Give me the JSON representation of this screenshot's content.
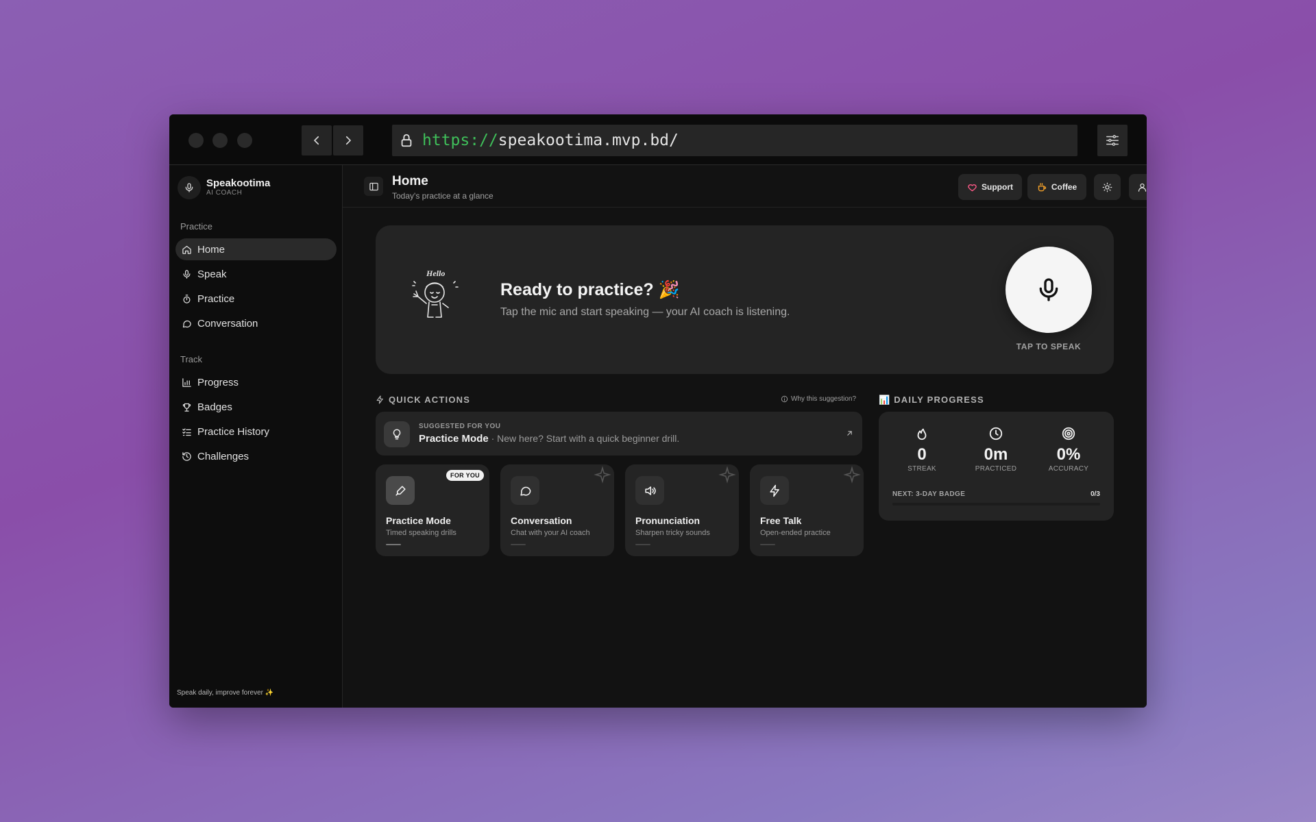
{
  "browser": {
    "url_scheme": "https://",
    "url_rest": "speakootima.mvp.bd/"
  },
  "sidebar": {
    "brand_name": "Speakootima",
    "brand_sub": "AI COACH",
    "section_practice": "Practice",
    "section_track": "Track",
    "items": [
      {
        "label": "Home",
        "icon": "home-icon",
        "active": true
      },
      {
        "label": "Speak",
        "icon": "mic-icon"
      },
      {
        "label": "Practice",
        "icon": "timer-icon"
      },
      {
        "label": "Conversation",
        "icon": "chat-icon"
      },
      {
        "label": "Progress",
        "icon": "bar-chart-icon"
      },
      {
        "label": "Badges",
        "icon": "trophy-icon"
      },
      {
        "label": "Practice History",
        "icon": "list-check-icon"
      },
      {
        "label": "Challenges",
        "icon": "history-icon"
      }
    ],
    "footer": "Speak daily, improve forever ✨"
  },
  "header": {
    "title": "Home",
    "subtitle": "Today's practice at a glance",
    "support_label": "Support",
    "coffee_label": "Coffee"
  },
  "hero": {
    "title": "Ready to practice? 🎉",
    "subtitle": "Tap the mic and start speaking — your AI coach is listening.",
    "illustration_text": "Hello",
    "tap_label": "TAP TO SPEAK"
  },
  "quick_actions": {
    "label": "QUICK ACTIONS",
    "why_label": "Why this suggestion?",
    "suggest_tag": "SUGGESTED FOR YOU",
    "suggest_mode": "Practice Mode",
    "suggest_text": "· New here? Start with a quick beginner drill.",
    "for_you_badge": "FOR YOU",
    "cards": [
      {
        "title": "Practice Mode",
        "sub": "Timed speaking drills",
        "icon": "pen-icon"
      },
      {
        "title": "Conversation",
        "sub": "Chat with your AI coach",
        "icon": "chat-icon"
      },
      {
        "title": "Pronunciation",
        "sub": "Sharpen tricky sounds",
        "icon": "speaker-icon"
      },
      {
        "title": "Free Talk",
        "sub": "Open-ended practice",
        "icon": "bolt-icon"
      }
    ]
  },
  "daily_progress": {
    "label": "📊 DAILY PROGRESS",
    "stats": [
      {
        "value": "0",
        "label": "STREAK",
        "icon": "flame-icon"
      },
      {
        "value": "0m",
        "label": "PRACTICED",
        "icon": "clock-icon"
      },
      {
        "value": "0%",
        "label": "ACCURACY",
        "icon": "target-icon"
      }
    ],
    "next_badge": "NEXT: 3-DAY BADGE",
    "next_count": "0/3",
    "next_progress": 0
  }
}
